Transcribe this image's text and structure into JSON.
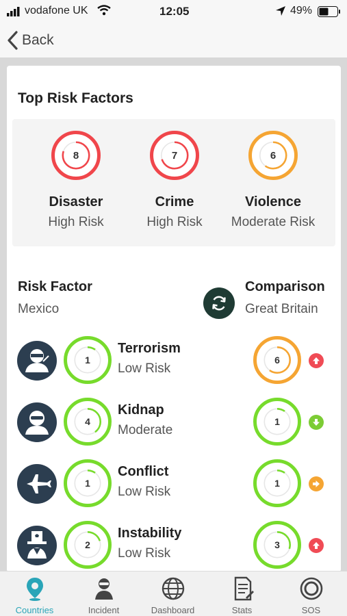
{
  "status_bar": {
    "carrier": "vodafone UK",
    "time": "12:05",
    "battery": "49%"
  },
  "nav": {
    "back_label": "Back"
  },
  "top_risk": {
    "title": "Top Risk Factors",
    "items": [
      {
        "score": "8",
        "value": 8,
        "name": "Disaster",
        "level": "High Risk",
        "color": "#f0464b"
      },
      {
        "score": "7",
        "value": 7,
        "name": "Crime",
        "level": "High Risk",
        "color": "#f0464b"
      },
      {
        "score": "6",
        "value": 6,
        "name": "Violence",
        "level": "Moderate Risk",
        "color": "#f5a533"
      }
    ]
  },
  "risk_header": {
    "left_title": "Risk Factor",
    "left_country": "Mexico",
    "right_title": "Comparison",
    "right_country": "Great Britain"
  },
  "risk_rows": [
    {
      "icon": "ninja-icon",
      "score": "1",
      "value": 1,
      "name": "Terrorism",
      "level": "Low Risk",
      "color": "#77db2c",
      "compare_score": "6",
      "compare_value": 6,
      "compare_color": "#f5a533",
      "trend": "up",
      "trend_color": "#f04b55"
    },
    {
      "icon": "masked-person-icon",
      "score": "4",
      "value": 4,
      "name": "Kidnap",
      "level": "Moderate",
      "color": "#77db2c",
      "compare_score": "1",
      "compare_value": 1,
      "compare_color": "#77db2c",
      "trend": "down",
      "trend_color": "#7ccc35"
    },
    {
      "icon": "fighter-jet-icon",
      "score": "1",
      "value": 1,
      "name": "Conflict",
      "level": "Low Risk",
      "color": "#77db2c",
      "compare_score": "1",
      "compare_value": 1,
      "compare_color": "#77db2c",
      "trend": "right",
      "trend_color": "#f5a533"
    },
    {
      "icon": "uncle-sam-icon",
      "score": "2",
      "value": 2,
      "name": "Instability",
      "level": "Low Risk",
      "color": "#77db2c",
      "compare_score": "3",
      "compare_value": 3,
      "compare_color": "#77db2c",
      "trend": "up",
      "trend_color": "#f04b55"
    }
  ],
  "tabs": [
    {
      "label": "Countries",
      "icon": "location-pin-icon",
      "active": true
    },
    {
      "label": "Incident",
      "icon": "incident-person-icon",
      "active": false
    },
    {
      "label": "Dashboard",
      "icon": "globe-icon",
      "active": false
    },
    {
      "label": "Stats",
      "icon": "document-icon",
      "active": false
    },
    {
      "label": "SOS",
      "icon": "sos-target-icon",
      "active": false
    }
  ],
  "colors": {
    "accent": "#2aa5b8",
    "high": "#f0464b",
    "moderate": "#f5a533",
    "low": "#77db2c",
    "swap": "#1f3b34"
  }
}
